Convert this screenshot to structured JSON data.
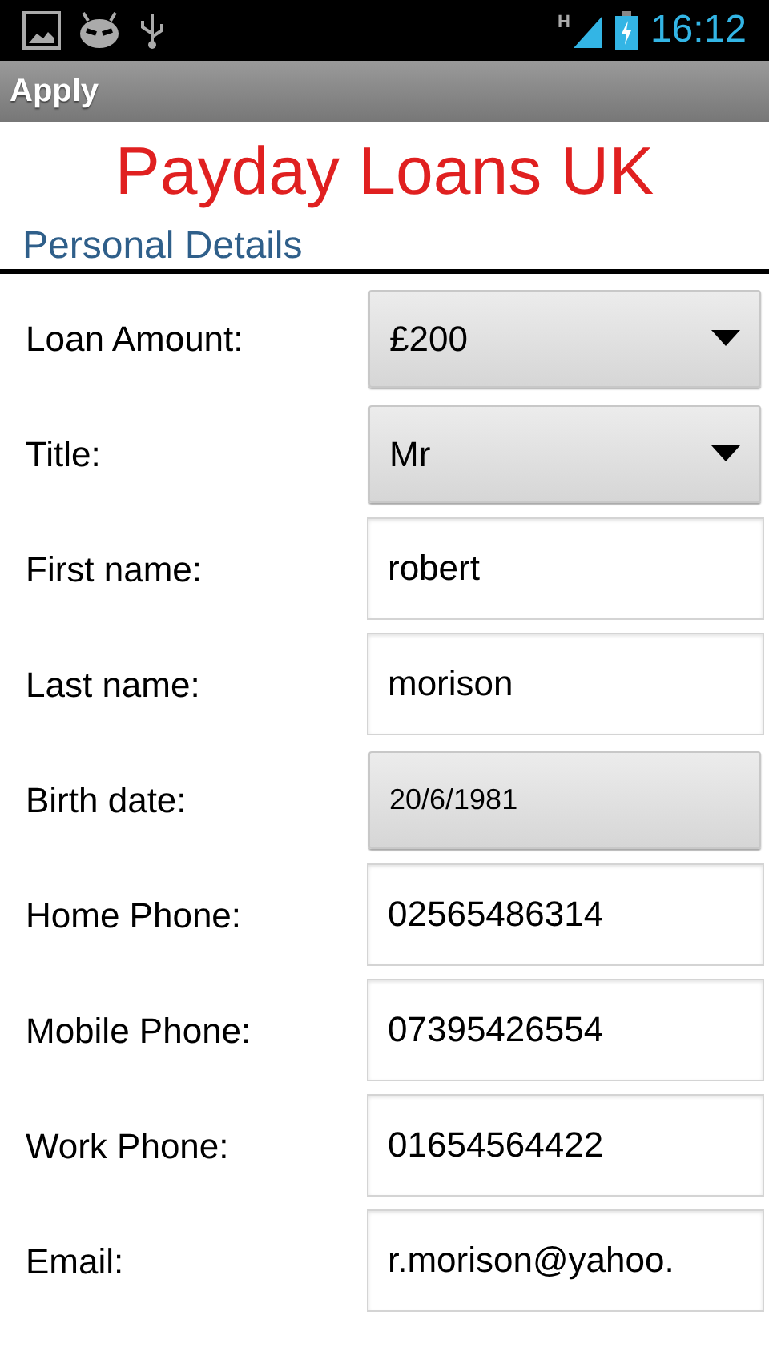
{
  "status_bar": {
    "time": "16:12",
    "network": "H"
  },
  "action_bar": {
    "title": "Apply"
  },
  "heading": "Payday Loans UK",
  "section": "Personal Details",
  "fields": [
    {
      "label": "Loan Amount:",
      "kind": "select",
      "value": "£200"
    },
    {
      "label": "Title:",
      "kind": "select",
      "value": "Mr"
    },
    {
      "label": "First name:",
      "kind": "text",
      "value": "robert"
    },
    {
      "label": "Last name:",
      "kind": "text",
      "value": "morison"
    },
    {
      "label": "Birth date:",
      "kind": "date",
      "value": "20/6/1981"
    },
    {
      "label": "Home Phone:",
      "kind": "text",
      "value": "02565486314"
    },
    {
      "label": "Mobile Phone:",
      "kind": "text",
      "value": "07395426554"
    },
    {
      "label": "Work Phone:",
      "kind": "text",
      "value": "01654564422"
    },
    {
      "label": "Email:",
      "kind": "text",
      "value": "r.morison@yahoo."
    }
  ]
}
